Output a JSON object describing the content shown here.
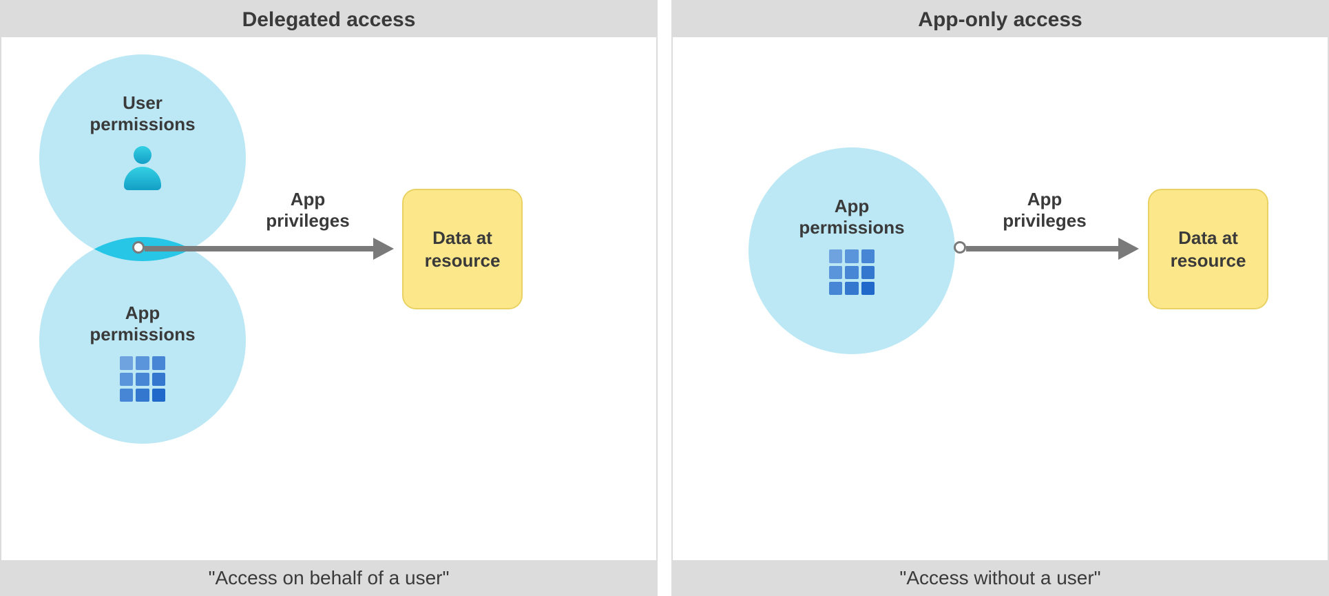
{
  "left": {
    "title": "Delegated access",
    "footer": "\"Access on behalf of a user\"",
    "user_perm_line1": "User",
    "user_perm_line2": "permissions",
    "app_perm_line1": "App",
    "app_perm_line2": "permissions",
    "privileges_line1": "App",
    "privileges_line2": "privileges",
    "data_line1": "Data at",
    "data_line2": "resource"
  },
  "right": {
    "title": "App-only access",
    "footer": "\"Access without a user\"",
    "app_perm_line1": "App",
    "app_perm_line2": "permissions",
    "privileges_line1": "App",
    "privileges_line2": "privileges",
    "data_line1": "Data at",
    "data_line2": "resource"
  },
  "colors": {
    "circle": "#bce8f5",
    "lens": "#27c6e6",
    "arrow": "#7a7a7a",
    "box": "#fce88a",
    "header_bg": "#dcdcdc"
  }
}
